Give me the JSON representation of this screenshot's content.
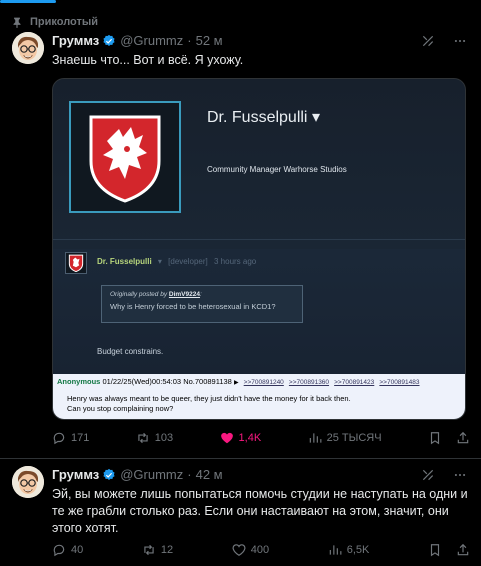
{
  "pinned": {
    "label": "Приколотый"
  },
  "tweets": [
    {
      "name": "Груммз",
      "handle": "@Grummz",
      "separator": "·",
      "time": "52 м",
      "text": "Знаешь что... Вот и всё. Я ухожу.",
      "replies": "171",
      "retweets": "103",
      "likes": "1,4K",
      "views": "25 ТЫСЯЧ",
      "liked": true
    },
    {
      "name": "Груммз",
      "handle": "@Grummz",
      "separator": "·",
      "time": "42 м",
      "text": "Эй, вы можете лишь попытаться помочь студии не наступать на одни и те же грабли столько раз. Если они настаивают на этом, значит, они этого хотят.",
      "replies": "40",
      "retweets": "12",
      "likes": "400",
      "views": "6,5K",
      "liked": false
    }
  ],
  "media": {
    "developer_name": "Dr. Fusselpulli",
    "developer_role": "Community Manager Warhorse Studios",
    "comment": {
      "author": "Dr. Fusselpulli",
      "tag": "[developer]",
      "time": "3 hours ago",
      "quote_prefix": "Originally posted by",
      "quote_author": "DimV9224",
      "quote_text": "Why is Henry forced to be heterosexual in KCD1?",
      "reply": "Budget constrains."
    },
    "chan": {
      "name": "Anonymous",
      "meta": "01/22/25(Wed)00:54:03 No.700891138",
      "links": [
        ">>700891240",
        ">>700891360",
        ">>700891423",
        ">>700891483"
      ],
      "line1": "Henry was always meant to be queer, they just didn't have the money for it back then.",
      "line2": "Can you stop complaining now?"
    }
  },
  "colors": {
    "accent": "#1d9bf0",
    "like": "#f91880",
    "muted": "#71767b"
  }
}
